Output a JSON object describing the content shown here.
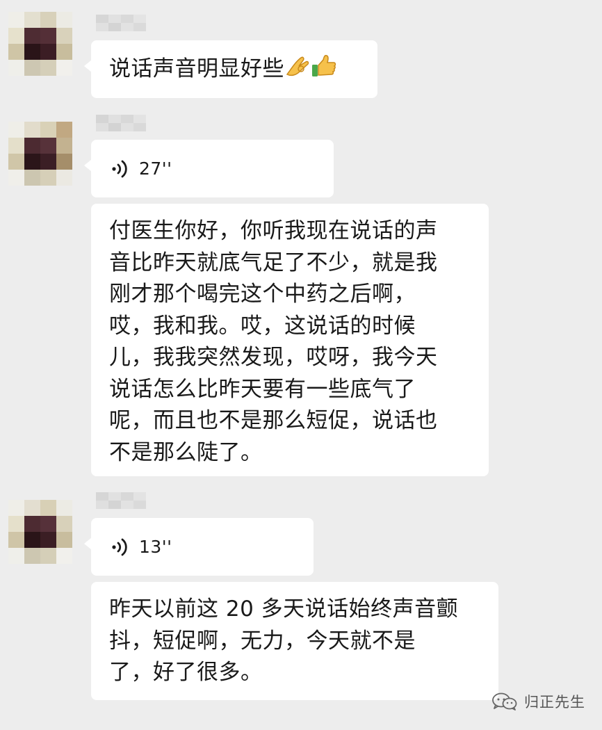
{
  "conversation": {
    "messages": [
      {
        "type": "text",
        "text": "说话声音明显好些",
        "emoji": [
          "ok-hand-emoji",
          "thumbs-up-emoji"
        ]
      },
      {
        "type": "voice",
        "duration": "27''"
      },
      {
        "type": "text",
        "lines": [
          "付医生你好，你听我现在说话的声",
          "音比昨天就底气足了不少，就是我",
          "刚才那个喝完这个中药之后啊，",
          "哎，我和我。哎，这说话的时候",
          "儿，我我突然发现，哎呀，我今天",
          "说话怎么比昨天要有一些底气了",
          "呢，而且也不是那么短促，说话也",
          "不是那么陡了。"
        ]
      },
      {
        "type": "voice",
        "duration": "13''"
      },
      {
        "type": "text",
        "lines": [
          "昨天以前这 20 多天说话始终声音颤",
          "抖，短促啊，无力，今天就不是",
          "了，好了很多。"
        ]
      }
    ]
  },
  "watermark": {
    "icon": "wechat-icon",
    "text": "归正先生"
  },
  "colors": {
    "background": "#ededed",
    "bubble": "#ffffff",
    "text": "#191919"
  }
}
